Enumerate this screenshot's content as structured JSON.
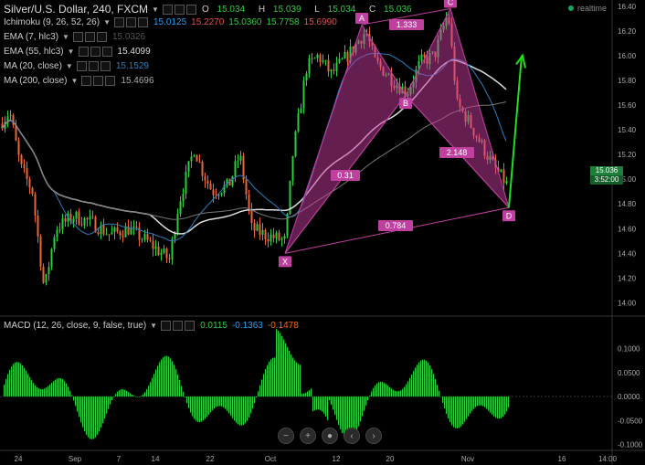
{
  "header": {
    "symbol_title": "Silver/U.S. Dollar, 240, FXCM",
    "ohlc": {
      "o_label": "O",
      "o": "15.034",
      "h_label": "H",
      "h": "15.039",
      "l_label": "L",
      "l": "15.034",
      "c_label": "C",
      "c": "15.036"
    },
    "realtime_label": "realtime"
  },
  "indicators": [
    {
      "label": "Ichimoku (9, 26, 52, 26)",
      "values": [
        "15.0125",
        "15.2270",
        "15.0360",
        "15.7758",
        "15.6990"
      ],
      "colors": [
        "#2a9df4",
        "#e05252",
        "#2ecc40",
        "#2ecc40",
        "#e05252"
      ]
    },
    {
      "label": "EMA (7, hlc3)",
      "values": [
        "15.0326"
      ],
      "colors": [
        "#555555"
      ]
    },
    {
      "label": "EMA (55, hlc3)",
      "values": [
        "15.4099"
      ],
      "colors": [
        "#dddddd"
      ]
    },
    {
      "label": "MA (20, close)",
      "values": [
        "15.1529"
      ],
      "colors": [
        "#2a7fbf"
      ]
    },
    {
      "label": "MA (200, close)",
      "values": [
        "15.4696"
      ],
      "colors": [
        "#aaaaaa"
      ]
    }
  ],
  "macd": {
    "label": "MACD (12, 26, close, 9, false, true)",
    "values": [
      "0.0115",
      "-0.1363",
      "-0.1478"
    ],
    "colors": [
      "#2ecc40",
      "#2a9df4",
      "#ff6a00"
    ]
  },
  "price_tags": {
    "last": "15.036",
    "timer": "3:52:00"
  },
  "colors": {
    "up": "#2ecc40",
    "down": "#e8663a",
    "pattern": "#c040a0",
    "pattern_fill": "rgba(200,60,160,0.5)",
    "arrow": "#22dd22"
  },
  "chart_data": {
    "type": "candlestick",
    "price_axis": {
      "ylim": [
        13.9,
        16.45
      ],
      "ticks": [
        14.0,
        14.2,
        14.4,
        14.6,
        14.8,
        15.0,
        15.2,
        15.4,
        15.6,
        15.8,
        16.0,
        16.2,
        16.4
      ]
    },
    "macd_axis": {
      "ylim": [
        -0.11,
        0.135
      ],
      "ticks": [
        0.1,
        0.05,
        0.0,
        -0.05,
        -0.1
      ]
    },
    "x_ticks": [
      "24",
      "Sep",
      "7",
      "14",
      "22",
      "Oct",
      "12",
      "20",
      "Nov",
      "16",
      "14:00"
    ],
    "harmonic_pattern": {
      "points": [
        {
          "label": "X",
          "price": 14.4
        },
        {
          "label": "A",
          "price": 16.25
        },
        {
          "label": "B",
          "price": 15.68
        },
        {
          "label": "C",
          "price": 16.38
        },
        {
          "label": "D",
          "price": 14.77
        }
      ],
      "ratios": {
        "XB": "0.31",
        "AC": "1.333",
        "BD": "2.148",
        "XD": "0.784"
      }
    }
  }
}
